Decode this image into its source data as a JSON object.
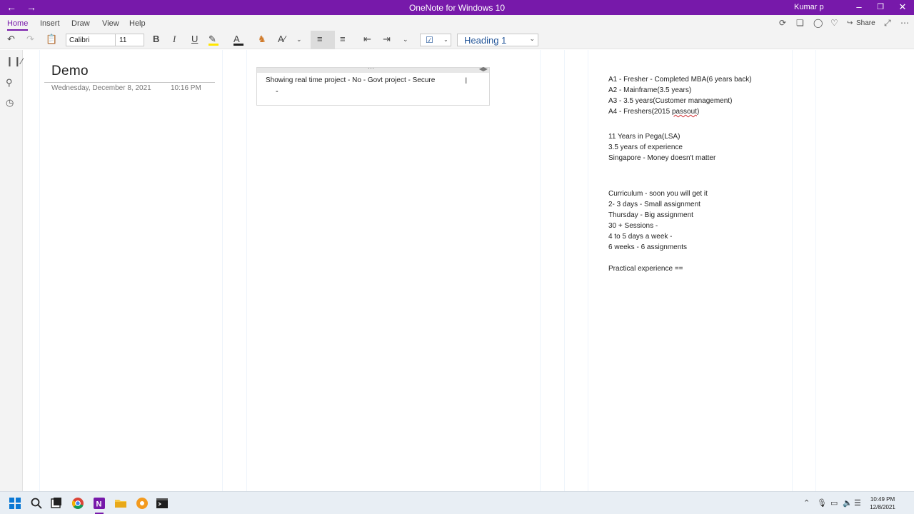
{
  "window": {
    "title": "OneNote for Windows 10",
    "user": "Kumar p",
    "back_icon": "arrow-left-icon",
    "forward_icon": "arrow-right-icon"
  },
  "menu": {
    "tabs": [
      "Home",
      "Insert",
      "Draw",
      "View",
      "Help"
    ],
    "active_tab": "Home",
    "share_label": "Share"
  },
  "toolbar": {
    "font_name": "Calibri",
    "font_size": "11",
    "bold": "B",
    "italic": "I",
    "underline": "U",
    "style_name": "Heading 1"
  },
  "page": {
    "title": "Demo",
    "date": "Wednesday, December 8, 2021",
    "time": "10:16 PM"
  },
  "note1": {
    "line1": "Showing real time project - No - Govt project - Secure",
    "line2": "-"
  },
  "note2": {
    "lines": [
      "A1 - Fresher - Completed MBA(6 years back)",
      "A2 - Mainframe(3.5 years)",
      "A3 - 3.5 years(Customer management)",
      "A4 - Freshers(2015 ",
      "",
      "11 Years in Pega(LSA)",
      "3.5 years of experience",
      "Singapore - Money doesn't matter",
      "",
      "",
      "Curriculum - soon you will get it",
      "2- 3 days - Small assignment",
      "Thursday - Big assignment",
      "30 + Sessions -",
      "4 to 5 days a week -",
      "6 weeks - 6 assignments",
      "",
      "Practical experience =="
    ],
    "a4_misspelled": "passout",
    "a4_suffix": ")"
  },
  "taskbar": {
    "time": "10:49 PM",
    "date": "12/8/2021"
  },
  "colors": {
    "accent": "#7719aa",
    "heading_style": "#2a5b9c",
    "highlight_yellow": "#ffe600",
    "font_color_red": "#c00000"
  }
}
